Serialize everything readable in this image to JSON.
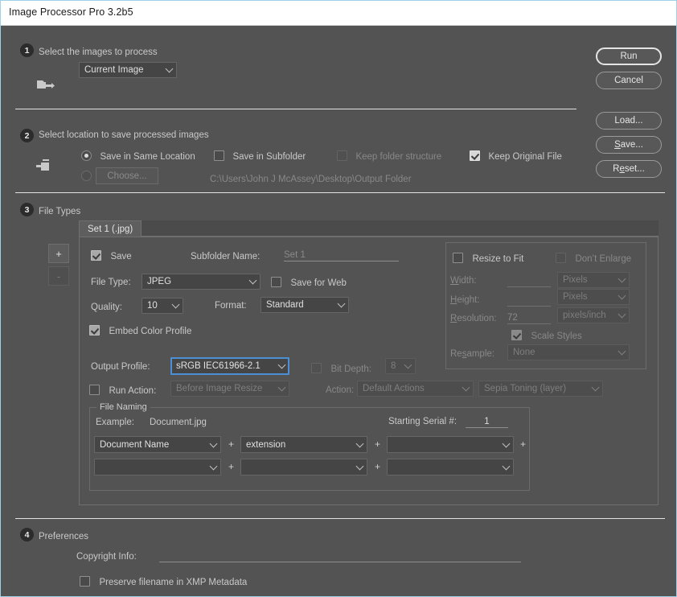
{
  "window": {
    "title": "Image Processor Pro 3.2b5"
  },
  "buttons": {
    "run": "Run",
    "cancel": "Cancel",
    "load": "Load...",
    "save": "Save...",
    "reset": "Reset..."
  },
  "step1": {
    "number": "1",
    "heading": "Select the images to process",
    "source_select": "Current Image"
  },
  "step2": {
    "number": "2",
    "heading": "Select location to save processed images",
    "save_same_location": "Save in Same Location",
    "save_in_subfolder": "Save in Subfolder",
    "keep_folder_structure": "Keep folder structure",
    "keep_original_file": "Keep Original File",
    "choose_button": "Choose...",
    "path": "C:\\Users\\John J McAssey\\Desktop\\Output Folder"
  },
  "step3": {
    "number": "3",
    "heading": "File Types",
    "add_button": "+",
    "remove_button": "-",
    "tab_label": "Set 1 (.jpg)",
    "save_checkbox": "Save",
    "subfolder_name_label": "Subfolder Name:",
    "subfolder_name_value": "Set 1",
    "file_type_label": "File Type:",
    "file_type_value": "JPEG",
    "save_for_web": "Save for Web",
    "quality_label": "Quality:",
    "quality_value": "10",
    "format_label": "Format:",
    "format_value": "Standard",
    "embed_color_profile": "Embed Color Profile",
    "output_profile_label": "Output Profile:",
    "output_profile_value": "sRGB IEC61966-2.1",
    "bit_depth_label": "Bit Depth:",
    "bit_depth_value": "8",
    "run_action_label": "Run Action:",
    "run_action_timing": "Before Image Resize",
    "action_label": "Action:",
    "action_set": "Default Actions",
    "action_name": "Sepia Toning (layer)",
    "resize": {
      "resize_to_fit": "Resize to Fit",
      "dont_enlarge": "Don’t Enlarge",
      "width_label": "Width:",
      "width_value": "",
      "width_unit": "Pixels",
      "height_label": "Height:",
      "height_value": "",
      "height_unit": "Pixels",
      "resolution_label": "Resolution:",
      "resolution_value": "72",
      "resolution_unit": "pixels/inch",
      "scale_styles": "Scale Styles",
      "resample_label": "Resample:",
      "resample_value": "None"
    },
    "file_naming": {
      "group_label": "File Naming",
      "example_label": "Example:",
      "example_value": "Document.jpg",
      "starting_serial_label": "Starting Serial #:",
      "starting_serial_value": "1",
      "token_r1c1": "Document Name",
      "token_r1c2": "extension",
      "token_r1c3": "",
      "token_r2c1": "",
      "token_r2c2": "",
      "token_r2c3": "",
      "plus": "+"
    }
  },
  "step4": {
    "number": "4",
    "heading": "Preferences",
    "copyright_label": "Copyright Info:",
    "copyright_value": "",
    "preserve_filename": "Preserve filename in XMP Metadata"
  },
  "colors": {
    "dialog_bg": "#535353",
    "title_bg": "#ffffff",
    "accent_focus": "#4d8fd4",
    "window_border": "#9ed0e8"
  }
}
